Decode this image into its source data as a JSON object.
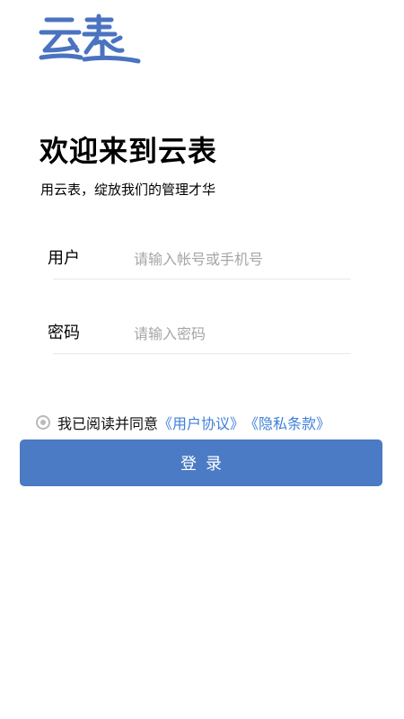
{
  "brand": {
    "logo_text": "云表",
    "logo_color": "#4a73c0"
  },
  "welcome": {
    "title": "欢迎来到云表",
    "subtitle": "用云表，绽放我们的管理才华"
  },
  "form": {
    "username": {
      "label": "用户",
      "placeholder": "请输入帐号或手机号",
      "value": ""
    },
    "password": {
      "label": "密码",
      "placeholder": "请输入密码",
      "value": ""
    }
  },
  "agreement": {
    "checked": false,
    "text": "我已阅读并同意",
    "user_agreement": "《用户协议》",
    "privacy_policy": "《隐私条款》",
    "link_color": "#3f7fd8"
  },
  "login_button": {
    "label": "登录",
    "color": "#4a7bc4"
  }
}
